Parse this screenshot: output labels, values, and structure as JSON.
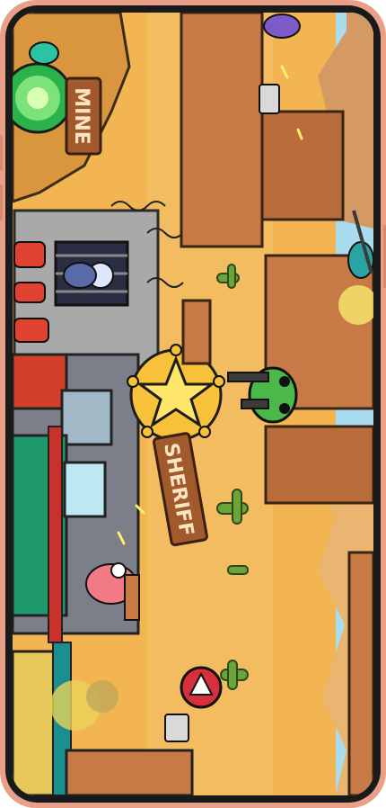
{
  "signs": {
    "mine": "MINE",
    "sheriff": "SHERIFF"
  },
  "colors": {
    "desert": "#f2b552",
    "canyon_rock": "#c77a45",
    "sky": "#a9dcee",
    "phone_frame": "#e8a088"
  },
  "icons": {
    "warning": "warning-triangle-icon",
    "sheriff_badge": "sheriff-star-icon",
    "portal": "green-portal-icon"
  }
}
